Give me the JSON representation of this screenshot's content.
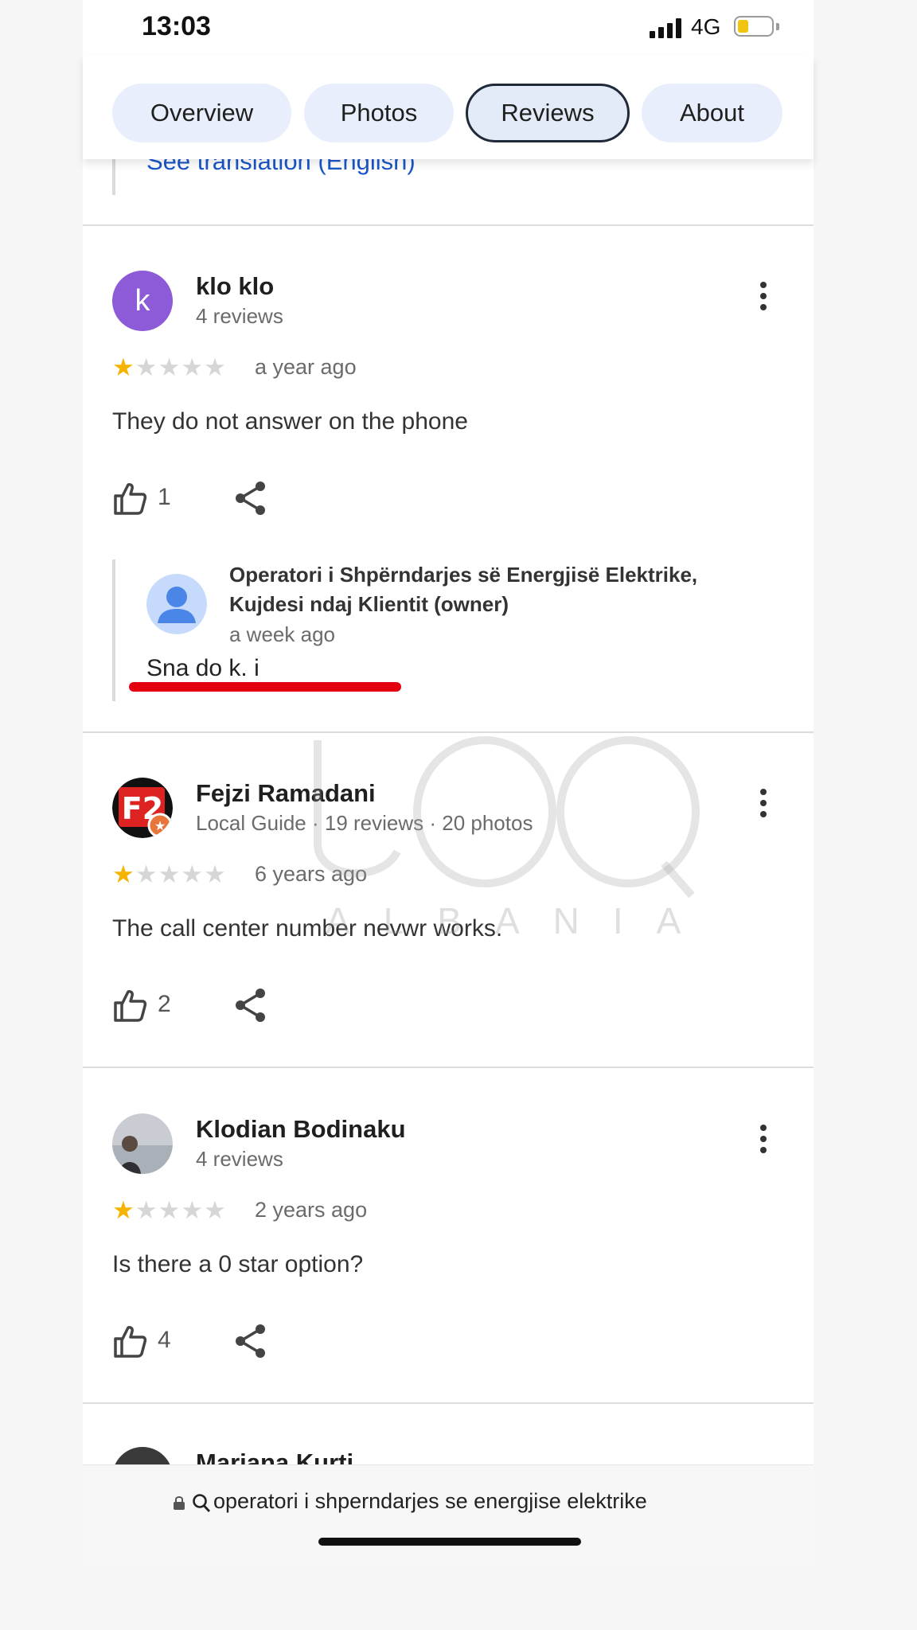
{
  "status_bar": {
    "time": "13:03",
    "network": "4G"
  },
  "tabs": [
    {
      "label": "Overview",
      "active": false
    },
    {
      "label": "Photos",
      "active": false
    },
    {
      "label": "Reviews",
      "active": true
    },
    {
      "label": "About",
      "active": false
    }
  ],
  "translation_link": "See translation (English)",
  "reviews": [
    {
      "name": "klo klo",
      "avatar_letter": "k",
      "meta": "4 reviews",
      "rating": 1,
      "age": "a year ago",
      "text": "They do not answer on the phone",
      "likes": "1",
      "owner_reply": {
        "name_line1": "Operatori i Shpërndarjes së Energjisë Elektrike,",
        "name_line2": "Kujdesi ndaj Klientit (owner)",
        "age": "a week ago",
        "text": "Sna do k. i"
      }
    },
    {
      "name": "Fejzi Ramadani",
      "avatar_letter": "F2",
      "meta": "Local Guide · 19 reviews · 20 photos",
      "rating": 1,
      "age": "6 years ago",
      "text": "The call center number nevwr works.",
      "likes": "2"
    },
    {
      "name": "Klodian Bodinaku",
      "meta": "4 reviews",
      "rating": 1,
      "age": "2 years ago",
      "text": "Is there a 0 star option?",
      "likes": "4"
    },
    {
      "name": "Mariana Kurti"
    }
  ],
  "watermark": {
    "text": "ALBANIA"
  },
  "address_bar": {
    "text": "operatori i shperndarjes se energjise elektrike"
  },
  "colors": {
    "star": "#f5b400",
    "link": "#1a56c9",
    "tab_bg": "#e8eefb",
    "highlight_line": "#e3000f"
  }
}
